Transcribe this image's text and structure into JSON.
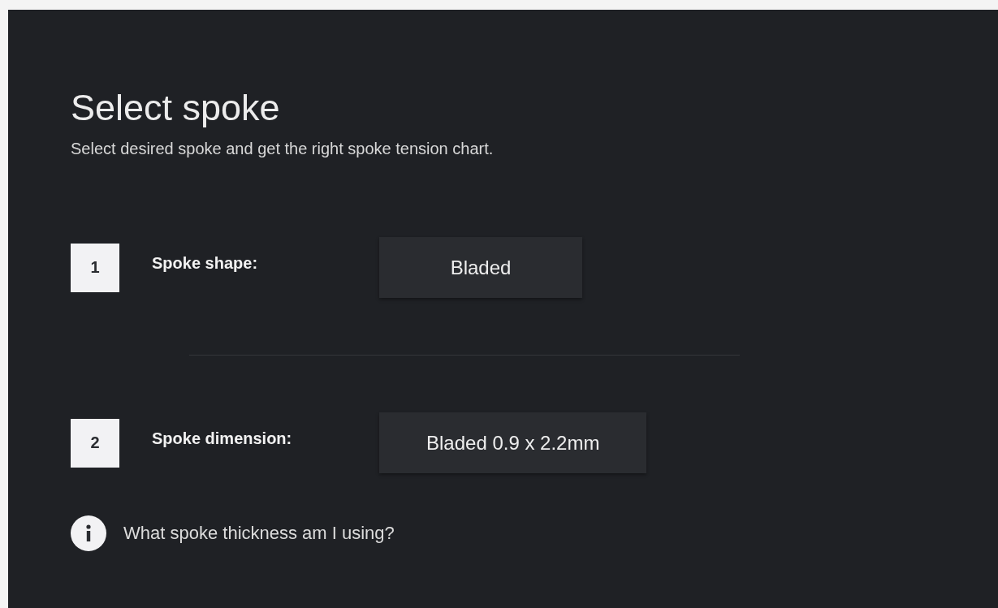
{
  "title": "Select spoke",
  "subtitle": "Select desired spoke and get the right spoke tension chart.",
  "steps": [
    {
      "number": "1",
      "label": "Spoke shape:",
      "value": "Bladed"
    },
    {
      "number": "2",
      "label": "Spoke dimension:",
      "value": "Bladed 0.9 x 2.2mm"
    }
  ],
  "help_link": "What spoke thickness am I using?"
}
